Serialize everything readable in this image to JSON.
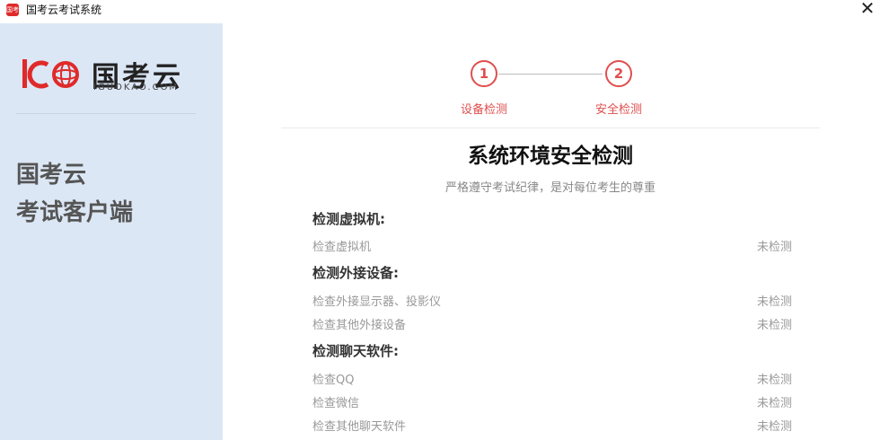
{
  "window": {
    "icon_text": "国考",
    "title": "国考云考试系统",
    "close_glyph": "✕"
  },
  "sidebar": {
    "logo_main": "国考云",
    "logo_sub": "IGUOKAO.COM",
    "heading_line1": "国考云",
    "heading_line2": "考试客户端"
  },
  "steps": [
    {
      "number": "1",
      "label": "设备检测"
    },
    {
      "number": "2",
      "label": "安全检测"
    }
  ],
  "main": {
    "title": "系统环境安全检测",
    "subtitle": "严格遵守考试纪律，是对每位考生的尊重"
  },
  "sections": [
    {
      "title": "检测虚拟机:",
      "items": [
        {
          "label": "检查虚拟机",
          "status": "未检测"
        }
      ]
    },
    {
      "title": "检测外接设备:",
      "items": [
        {
          "label": "检查外接显示器、投影仪",
          "status": "未检测"
        },
        {
          "label": "检查其他外接设备",
          "status": "未检测"
        }
      ]
    },
    {
      "title": "检测聊天软件:",
      "items": [
        {
          "label": "检查QQ",
          "status": "未检测"
        },
        {
          "label": "检查微信",
          "status": "未检测"
        },
        {
          "label": "检查其他聊天软件",
          "status": "未检测"
        }
      ]
    }
  ],
  "colors": {
    "accent": "#e04e4e",
    "brand_red": "#e02a2a",
    "sidebar_bg": "#dce7f5"
  }
}
